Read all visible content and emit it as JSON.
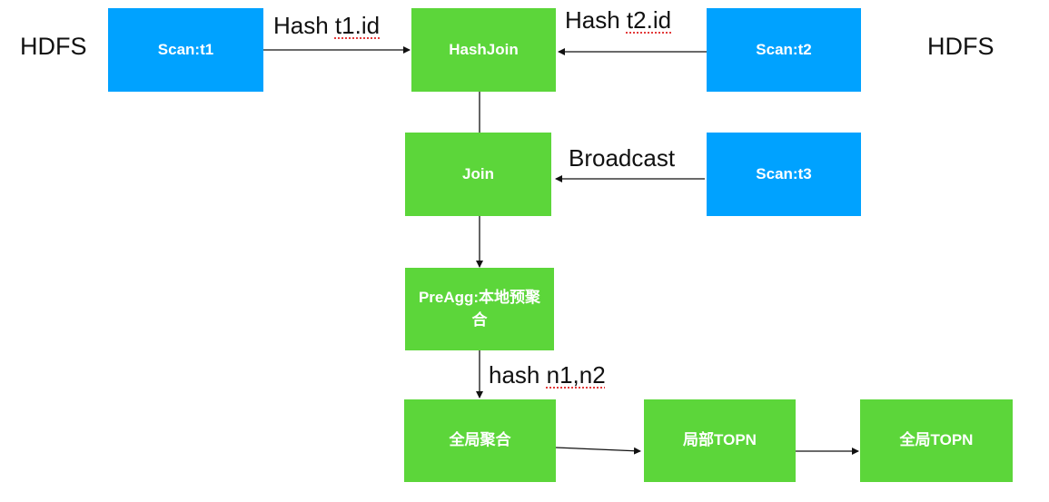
{
  "labels": {
    "hdfs_left": "HDFS",
    "hdfs_right": "HDFS"
  },
  "nodes": {
    "scan_t1": "Scan:t1",
    "hashjoin": "HashJoin",
    "scan_t2": "Scan:t2",
    "join": "Join",
    "scan_t3": "Scan:t3",
    "preagg": "PreAgg:本地预聚合",
    "global_agg": "全局聚合",
    "local_topn": "局部TOPN",
    "global_topn": "全局TOPN"
  },
  "edges": {
    "hash_t1": {
      "prefix": "Hash ",
      "key": "t1.id"
    },
    "hash_t2": {
      "prefix": "Hash ",
      "key": "t2.id"
    },
    "broadcast": "Broadcast",
    "hash_n": {
      "prefix": "hash ",
      "key": "n1,n2"
    }
  },
  "colors": {
    "scan": "#00a2ff",
    "operator": "#5cd63a",
    "edge": "#111111"
  }
}
